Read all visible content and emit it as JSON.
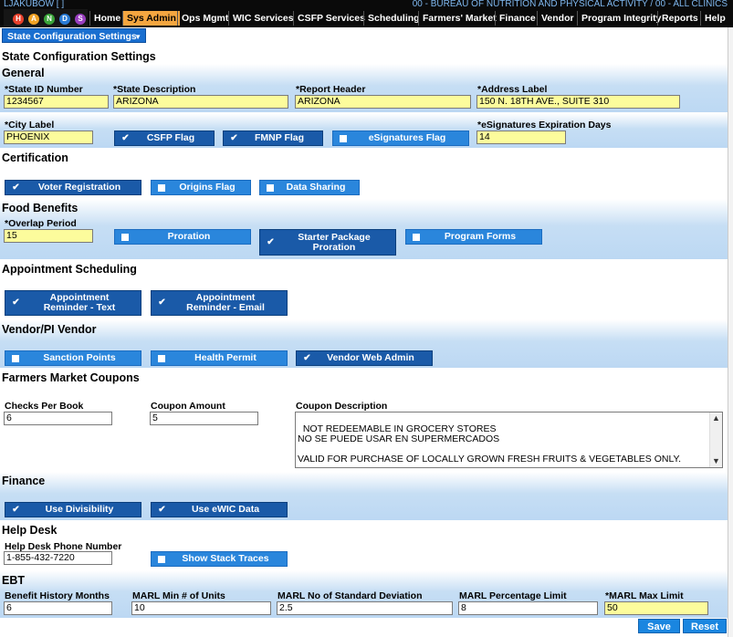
{
  "header": {
    "user": "LJAKUBOW [        ]",
    "clinic": "00 - BUREAU OF NUTRITION AND PHYSICAL ACTIVITY / 00 - ALL CLINICS",
    "logo_letters": [
      "H",
      "A",
      "N",
      "D",
      "S"
    ]
  },
  "menu": [
    "Home",
    "Sys Admin",
    "Ops Mgmt",
    "WIC Services",
    "CSFP Services",
    "Scheduling",
    "Farmers' Market",
    "Finance",
    "Vendor",
    "Program Integrity",
    "Reports",
    "Help"
  ],
  "page_selector": "State Configuration Settings",
  "page_title": "State Configuration Settings",
  "general": {
    "title": "General",
    "state_id_label": "*State ID Number",
    "state_id": "1234567",
    "state_desc_label": "*State Description",
    "state_desc": "ARIZONA",
    "report_header_label": "*Report Header",
    "report_header": "ARIZONA",
    "address_label_label": "*Address Label",
    "address_label": "150 N. 18TH AVE., SUITE 310",
    "city_label_label": "*City Label",
    "city_label": "PHOENIX",
    "csfp_flag": "CSFP Flag",
    "fmnp_flag": "FMNP Flag",
    "esig_flag": "eSignatures Flag",
    "esig_days_label": "*eSignatures Expiration Days",
    "esig_days": "14"
  },
  "certification": {
    "title": "Certification",
    "voter": "Voter Registration",
    "origins": "Origins Flag",
    "sharing": "Data Sharing"
  },
  "food": {
    "title": "Food Benefits",
    "overlap_label": "*Overlap Period",
    "overlap": "15",
    "proration": "Proration",
    "starter": "Starter Package Proration",
    "forms": "Program Forms"
  },
  "appointment": {
    "title": "Appointment Scheduling",
    "text": "Appointment Reminder - Text",
    "email": "Appointment Reminder - Email"
  },
  "vendor": {
    "title": "Vendor/PI Vendor",
    "sanction": "Sanction Points",
    "health": "Health Permit",
    "webadmin": "Vendor Web Admin"
  },
  "farmers": {
    "title": "Farmers Market Coupons",
    "checks_label": "Checks Per Book",
    "checks": "6",
    "amount_label": "Coupon Amount",
    "amount": "5",
    "desc_label": "Coupon Description",
    "desc": "NOT REDEEMABLE IN GROCERY STORES\nNO SE PUEDE USAR EN SUPERMERCADOS\n\nVALID FOR PURCHASE OF LOCALLY GROWN FRESH FRUITS & VEGETABLES ONLY."
  },
  "finance": {
    "title": "Finance",
    "divisibility": "Use Divisibility",
    "ewic": "Use eWIC Data"
  },
  "helpdesk": {
    "title": "Help Desk",
    "phone_label": "Help Desk Phone Number",
    "phone": "1-855-432-7220",
    "stack": "Show Stack Traces"
  },
  "ebt": {
    "title": "EBT",
    "months_label": "Benefit History Months",
    "months": "6",
    "min_label": "MARL Min # of Units",
    "min": "10",
    "std_label": "MARL No of Standard Deviation",
    "std": "2.5",
    "pct_label": "MARL Percentage Limit",
    "pct": "8",
    "max_label": "*MARL Max Limit",
    "max": "50"
  },
  "footer": {
    "save": "Save",
    "reset": "Reset"
  },
  "colors": {
    "menu_active": "#f4a640",
    "button_dark": "#1a5aa8",
    "button_light": "#2a86dc",
    "required_field": "#fcfc9c",
    "band": "#c6def4"
  }
}
